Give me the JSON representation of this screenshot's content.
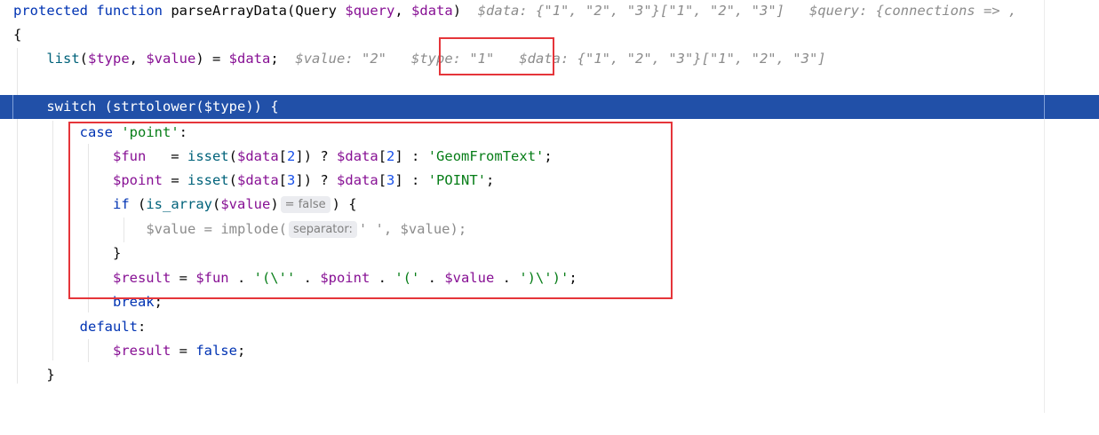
{
  "editor": {
    "lines": {
      "l1": {
        "kw_protected": "protected",
        "kw_function": "function",
        "fn_name": "parseArrayData",
        "p_open": "(",
        "type": "Query",
        "sp": " ",
        "arg_query": "$query",
        "comma": ", ",
        "arg_data": "$data",
        "p_close": ")",
        "hint_data": "$data: {\"1\", \"2\", \"3\"}[\"1\", \"2\", \"3\"]",
        "hint_query": "$query: {connections => ,"
      },
      "l2": {
        "brace": "{"
      },
      "l3": {
        "kw_list": "list",
        "p_open": "(",
        "type_var": "$type",
        "comma": ", ",
        "value_var": "$value",
        "close_assign": ") = ",
        "data_var": "$data",
        "semi": ";",
        "hint_value": "$value: \"2\"",
        "hint_type": "$type: \"1\"",
        "hint_data": "$data: {\"1\", \"2\", \"3\"}[\"1\", \"2\", \"3\"]"
      },
      "l5": {
        "kw_switch": "switch",
        "open": " (",
        "fn": "strtolower",
        "p_open": "(",
        "var": "$type",
        "close": ")) {"
      },
      "l6": {
        "kw_case": "case",
        "sp": " ",
        "str": "'point'",
        "colon": ":"
      },
      "l7": {
        "var_fun": "$fun",
        "assign": "   = ",
        "fn_isset": "isset",
        "p_open": "(",
        "var_data": "$data",
        "idx_open": "[",
        "idx": "2",
        "idx_close": "]) ? ",
        "var_data2": "$data",
        "idx_open2": "[",
        "idx2": "2",
        "idx_close2": "] : ",
        "str": "'GeomFromText'",
        "semi": ";"
      },
      "l8": {
        "var_point": "$point",
        "assign": " = ",
        "fn_isset": "isset",
        "p_open": "(",
        "var_data": "$data",
        "idx_open": "[",
        "idx": "3",
        "idx_close": "]) ? ",
        "var_data2": "$data",
        "idx_open2": "[",
        "idx2": "3",
        "idx_close2": "] : ",
        "str": "'POINT'",
        "semi": ";"
      },
      "l9": {
        "kw_if": "if",
        "open": " (",
        "fn": "is_array",
        "p_open": "(",
        "var": "$value",
        "p_close": ")",
        "hint": "= false",
        "close": ") {"
      },
      "l10": {
        "var": "$value",
        "assign": " = ",
        "fn": "implode",
        "p_open": "(",
        "hint": "separator:",
        "str": "' '",
        "comma": ", ",
        "var2": "$value",
        "close": ");"
      },
      "l11": {
        "brace": "}"
      },
      "l12": {
        "var_result": "$result",
        "assign": " = ",
        "var_fun": "$fun",
        "dot1": " . ",
        "str1": "'(\\''",
        "dot2": " . ",
        "var_point": "$point",
        "dot3": " . ",
        "str2": "'('",
        "dot4": " . ",
        "var_value": "$value",
        "dot5": " . ",
        "str3": "')\\')'",
        "semi": ";"
      },
      "l13": {
        "kw_break": "break",
        "semi": ";"
      },
      "l14": {
        "kw_default": "default",
        "colon": ":"
      },
      "l15": {
        "var_result": "$result",
        "assign": " = ",
        "kw_false": "false",
        "semi": ";"
      },
      "l16": {
        "brace": "}"
      }
    }
  },
  "colors": {
    "keyword": "#0033b3",
    "variable": "#871094",
    "string": "#067d17",
    "number": "#1750eb",
    "function_call": "#00627a",
    "inlay_hint": "#8c8c8c",
    "current_line": "#2150a8",
    "annotation_box": "#e5353a"
  }
}
